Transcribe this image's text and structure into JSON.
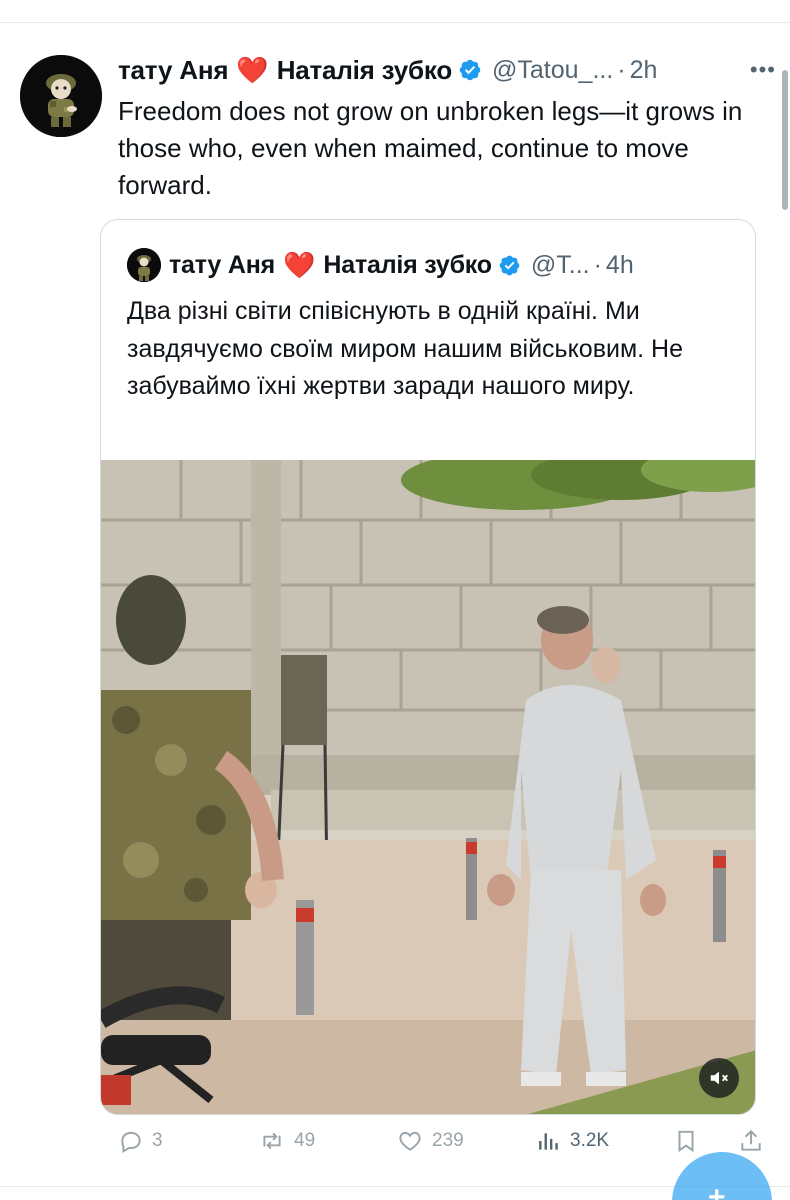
{
  "tweet": {
    "name_part1": "тату Аня",
    "heart": "❤️",
    "name_part2": "Наталія зубко",
    "handle": "@Tatou_...",
    "separator": "·",
    "time": "2h",
    "more": "•••",
    "text": "Freedom does not grow on unbroken legs—it grows in those who, even when maimed, continue to move forward."
  },
  "quote": {
    "name_part1": "тату Аня",
    "heart": "❤️",
    "name_part2": "Наталія зубко",
    "handle": "@T...",
    "separator": "·",
    "time": "4h",
    "text": "Два різні світи співіснують в одній країні. Ми завдячуємо своїм миром нашим військовим. Не забуваймо їхні жертви заради нашого миру.",
    "media": {
      "mute_icon": "speaker-muted-icon"
    }
  },
  "actions": {
    "replies": "3",
    "reposts": "49",
    "likes": "239",
    "views": "3.2K"
  },
  "colors": {
    "accent": "#1d9bf0",
    "verified": "#1d9bf0",
    "heart": "#e0245e",
    "secondary_text": "#536471",
    "border": "#cfd9de"
  },
  "icons": [
    "reply-icon",
    "repost-icon",
    "like-icon",
    "views-icon",
    "bookmark-icon",
    "share-icon",
    "verified-badge-icon",
    "more-icon",
    "compose-icon"
  ]
}
